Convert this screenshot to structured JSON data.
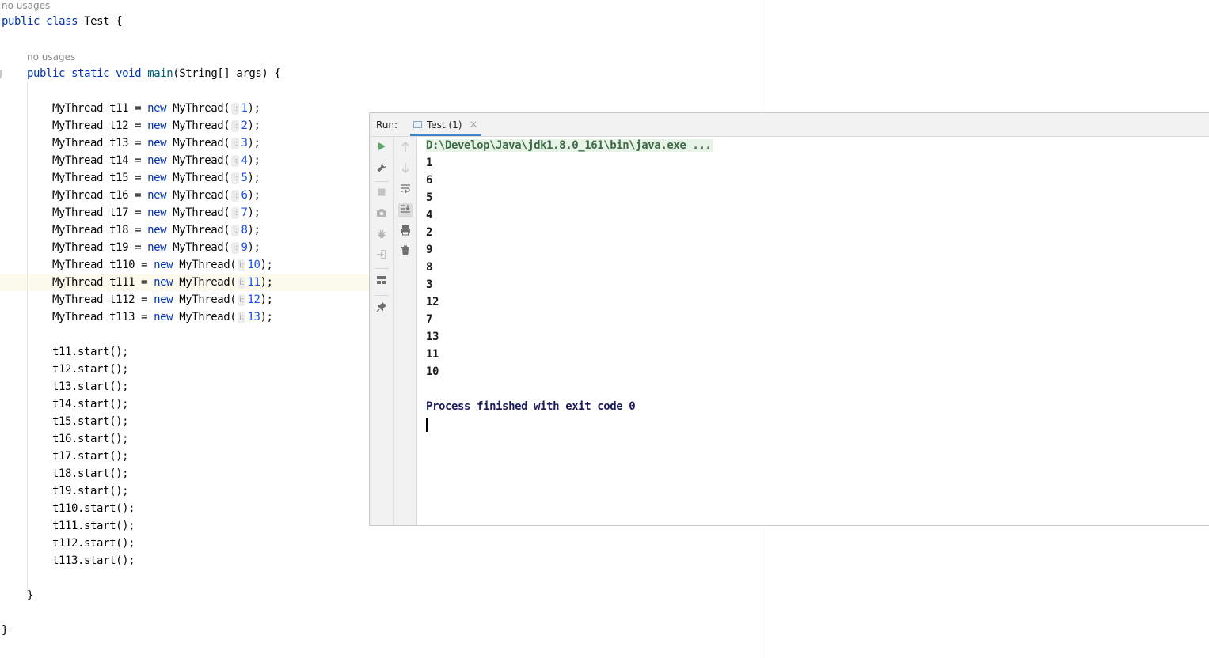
{
  "editor": {
    "usage_hint_class": "no usages",
    "usage_hint_main": "no usages",
    "class_decl": {
      "kw1": "public",
      "kw2": "class",
      "name": "Test {"
    },
    "main_decl": {
      "kw1": "public",
      "kw2": "static",
      "kw3": "void",
      "fn": "main",
      "rest": "(String[] args) {"
    },
    "param_hint": "i:",
    "kw_new": "new",
    "threads": [
      {
        "decl": "MyThread t11 = ",
        "type": "MyThread(",
        "arg": "1",
        "end": ");"
      },
      {
        "decl": "MyThread t12 = ",
        "type": "MyThread(",
        "arg": "2",
        "end": ");"
      },
      {
        "decl": "MyThread t13 = ",
        "type": "MyThread(",
        "arg": "3",
        "end": ");"
      },
      {
        "decl": "MyThread t14 = ",
        "type": "MyThread(",
        "arg": "4",
        "end": ");"
      },
      {
        "decl": "MyThread t15 = ",
        "type": "MyThread(",
        "arg": "5",
        "end": ");"
      },
      {
        "decl": "MyThread t16 = ",
        "type": "MyThread(",
        "arg": "6",
        "end": ");"
      },
      {
        "decl": "MyThread t17 = ",
        "type": "MyThread(",
        "arg": "7",
        "end": ");"
      },
      {
        "decl": "MyThread t18 = ",
        "type": "MyThread(",
        "arg": "8",
        "end": ");"
      },
      {
        "decl": "MyThread t19 = ",
        "type": "MyThread(",
        "arg": "9",
        "end": ");"
      },
      {
        "decl": "MyThread t110 = ",
        "type": "MyThread(",
        "arg": "10",
        "end": ");"
      },
      {
        "decl": "MyThread t111 = ",
        "type": "MyThread(",
        "arg": "11",
        "end": ");"
      },
      {
        "decl": "MyThread t112 = ",
        "type": "MyThread(",
        "arg": "12",
        "end": ");"
      },
      {
        "decl": "MyThread t113 = ",
        "type": "MyThread(",
        "arg": "13",
        "end": ");"
      }
    ],
    "starts": [
      "t11.start();",
      "t12.start();",
      "t13.start();",
      "t14.start();",
      "t15.start();",
      "t16.start();",
      "t17.start();",
      "t18.start();",
      "t19.start();",
      "t110.start();",
      "t111.start();",
      "t112.start();",
      "t113.start();"
    ],
    "close_method": "}",
    "close_class": "}"
  },
  "run_window": {
    "label": "Run:",
    "tab_label": "Test (1)",
    "tab_close": "×",
    "icons_left": [
      "rerun-icon",
      "wrench-icon",
      "stop-icon",
      "camera-icon",
      "debug-icon",
      "login-icon",
      "layout-icon",
      "pin-icon"
    ],
    "icons_right": [
      "arrow-up-icon",
      "arrow-down-icon",
      "soft-wrap-icon",
      "scroll-to-end-icon",
      "print-icon",
      "trash-icon"
    ],
    "console": {
      "command": "D:\\Develop\\Java\\jdk1.8.0_161\\bin\\java.exe ...",
      "output": [
        "1",
        "6",
        "5",
        "4",
        "2",
        "9",
        "8",
        "3",
        "12",
        "7",
        "13",
        "11",
        "10"
      ],
      "exit": "Process finished with exit code 0"
    }
  }
}
